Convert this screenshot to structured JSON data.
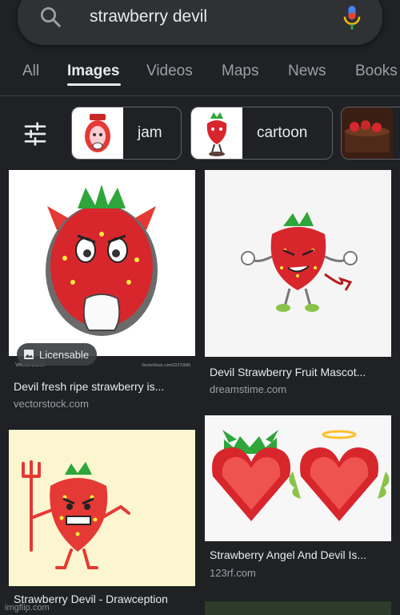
{
  "search": {
    "query": "strawberry devil"
  },
  "tabs": [
    {
      "label": "All"
    },
    {
      "label": "Images"
    },
    {
      "label": "Videos"
    },
    {
      "label": "Maps"
    },
    {
      "label": "News"
    },
    {
      "label": "Books"
    }
  ],
  "chips": [
    {
      "label": "jam"
    },
    {
      "label": "cartoon"
    }
  ],
  "results": [
    {
      "title": "Devil fresh ripe strawberry is...",
      "source": "vectorstock.com",
      "badge": "Licensable",
      "image_watermark_left": "VectorStock",
      "image_watermark_right": "VectorStock.com/22270586"
    },
    {
      "title": "Devil Strawberry Fruit Mascot...",
      "source": "dreamstime.com"
    },
    {
      "title": "Strawberry Devil - Drawception",
      "source": ""
    },
    {
      "title": "Strawberry Angel And Devil Is...",
      "source": "123rf.com"
    }
  ],
  "footer": {
    "watermark": "imgflip.com"
  },
  "colors": {
    "background": "#202124",
    "surface": "#303134",
    "text": "#e8eaed",
    "muted": "#9aa0a6",
    "strawberry": "#d8262d",
    "leaf": "#2ea63b"
  }
}
